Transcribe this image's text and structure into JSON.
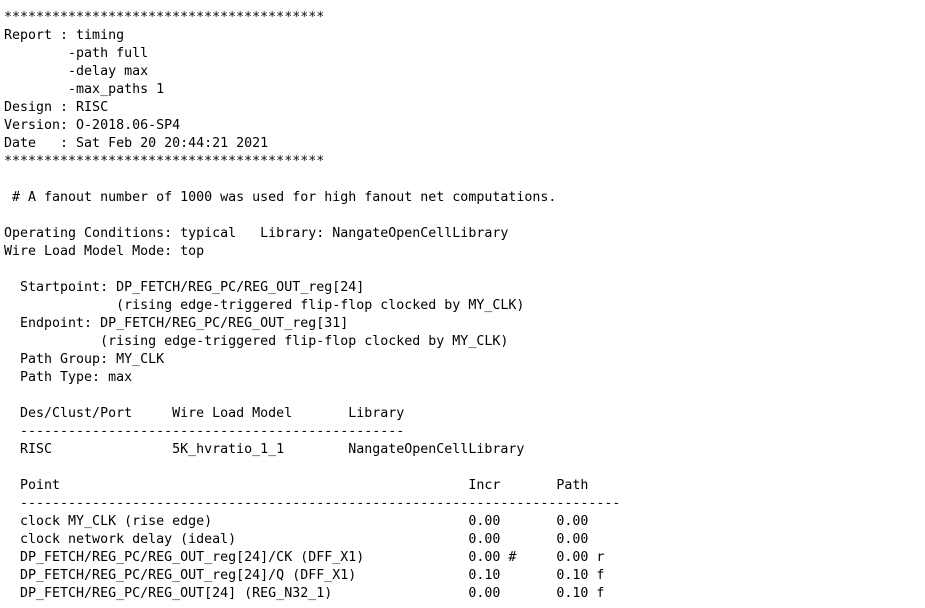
{
  "report_lines": [
    "****************************************",
    "Report : timing",
    "        -path full",
    "        -delay max",
    "        -max_paths 1",
    "Design : RISC",
    "Version: O-2018.06-SP4",
    "Date   : Sat Feb 20 20:44:21 2021",
    "****************************************",
    "",
    " # A fanout number of 1000 was used for high fanout net computations.",
    "",
    "Operating Conditions: typical   Library: NangateOpenCellLibrary",
    "Wire Load Model Mode: top",
    "",
    "  Startpoint: DP_FETCH/REG_PC/REG_OUT_reg[24]",
    "              (rising edge-triggered flip-flop clocked by MY_CLK)",
    "  Endpoint: DP_FETCH/REG_PC/REG_OUT_reg[31]",
    "            (rising edge-triggered flip-flop clocked by MY_CLK)",
    "  Path Group: MY_CLK",
    "  Path Type: max",
    "",
    "  Des/Clust/Port     Wire Load Model       Library",
    "  ------------------------------------------------",
    "  RISC               5K_hvratio_1_1        NangateOpenCellLibrary",
    "",
    "  Point                                                   Incr       Path",
    "  ---------------------------------------------------------------------------",
    "  clock MY_CLK (rise edge)                                0.00       0.00",
    "  clock network delay (ideal)                             0.00       0.00",
    "  DP_FETCH/REG_PC/REG_OUT_reg[24]/CK (DFF_X1)             0.00 #     0.00 r",
    "  DP_FETCH/REG_PC/REG_OUT_reg[24]/Q (DFF_X1)              0.10       0.10 f",
    "  DP_FETCH/REG_PC/REG_OUT[24] (REG_N32_1)                 0.00       0.10 f"
  ]
}
